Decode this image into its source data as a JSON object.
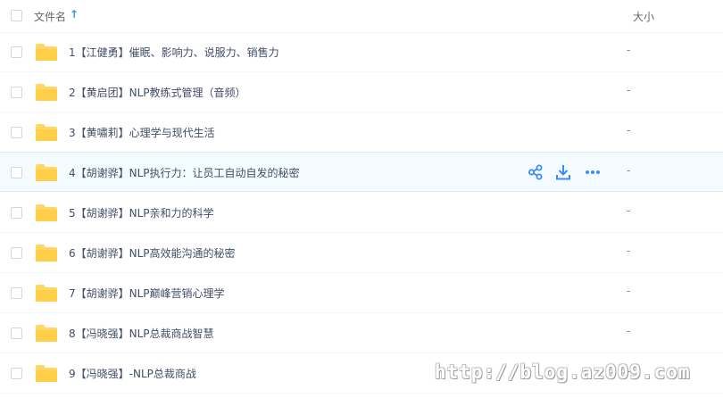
{
  "header": {
    "name_label": "文件名",
    "sort_icon": "arrow-up-icon",
    "size_label": "大小"
  },
  "rows": [
    {
      "name": "1【江健勇】催眠、影响力、说服力、销售力",
      "size": "-"
    },
    {
      "name": "2【黄启团】NLP教练式管理（音频）",
      "size": "-"
    },
    {
      "name": "3【黄嘯莉】心理学与现代生活",
      "size": "-"
    },
    {
      "name": "4【胡谢骅】NLP执行力：让员工自动自发的秘密",
      "size": "-"
    },
    {
      "name": "5【胡谢骅】NLP亲和力的科学",
      "size": "-"
    },
    {
      "name": "6【胡谢骅】NLP高效能沟通的秘密",
      "size": "-"
    },
    {
      "name": "7【胡谢骅】NLP巅峰营销心理学",
      "size": "-"
    },
    {
      "name": "8【冯晓强】NLP总裁商战智慧",
      "size": "-"
    },
    {
      "name": "9【冯晓强】-NLP总裁商战",
      "size": "-"
    }
  ],
  "row_actions": {
    "share_icon": "share-icon",
    "download_icon": "download-icon",
    "more_icon": "more-icon"
  },
  "colors": {
    "folder": "#ffd766",
    "accent": "#3b8cff",
    "hover_row": "#f4fbff"
  },
  "watermark": "http://blog.az009.com"
}
